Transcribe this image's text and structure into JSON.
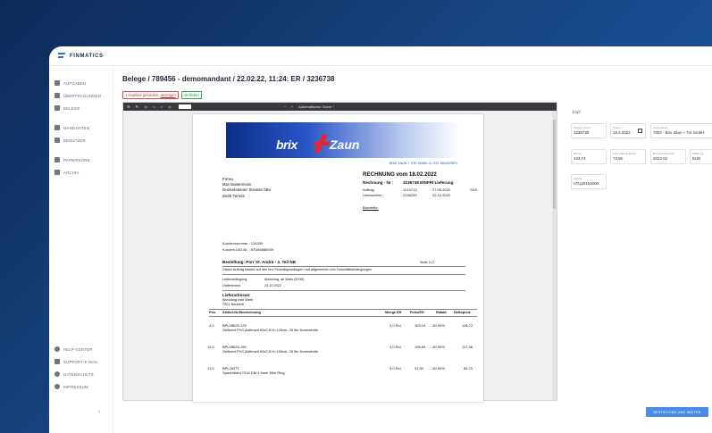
{
  "app": {
    "logo_text": "FINMATICS"
  },
  "sidebar": {
    "items": [
      {
        "label": "AUFGABEN"
      },
      {
        "label": "ÜBERTRAGUNGEN"
      },
      {
        "label": "BELEGE"
      },
      {
        "label": "MANDANTEN"
      },
      {
        "label": "BENUTZER"
      },
      {
        "label": "PAPIERKORB"
      },
      {
        "label": "ARCHIV"
      }
    ],
    "bottom_items": [
      {
        "label": "HELP-CENTER"
      },
      {
        "label": "SUPPORT-E-MAIL"
      },
      {
        "label": "DATENSCHUTZ"
      },
      {
        "label": "IMPRESSUM"
      }
    ],
    "collapse": "‹"
  },
  "header": {
    "title": "Belege / 789456 - demomandant / 22.02.22, 11:24: ER / 3236738",
    "duplicate_text": "1 Duplikat gefunden:",
    "duplicate_link": "anzeigen",
    "verified": "Verifiziert"
  },
  "viewer": {
    "zoom_label": "Automatischer Zoom ÷",
    "page_number": "",
    "toolbar_icons": [
      "☰",
      "🔍",
      "|<",
      "<",
      ">",
      ">|",
      "−",
      "+"
    ]
  },
  "invoice": {
    "brand_left": "brix",
    "brand_right": "Zaun",
    "address_line": "BRIX ZAUN + TOR GMBH, A-7221 NEUDÖRFL",
    "title": "RECHNUNG  vom  18.02.2022",
    "rechnung_nr_label": "Rechnung - Nr :",
    "rechnung_nr_value": "3236738 EINFRI Lieferung",
    "auftrag_label": "Auftrag",
    "auftrag_value": "1213713",
    "auftrag_date": "27.05.2022",
    "sas": "SAS",
    "lieferschein_label": "Lieferschein",
    "lieferschein_value": "2246293",
    "lieferschein_date": "22.10.2022",
    "baustelle": "Baustelle:",
    "firma": "Firma",
    "name": "Max Mustermann",
    "street": "Dunkelsteiner Strasse 09a",
    "city": "2630 Ternitz",
    "kundennummer": "Kundennummer : 126309",
    "uid": "Kunden-UID-Nr. : ATU66666939",
    "bestellung": "Bestellung:  Porr St. Andrä - 3. Teil  NB",
    "seite": "Seite      1/   2",
    "agb_note": "Dieser Auftrag basiert auf den brix Produktgrundlagen und allgemeinen brix-Geschäftsbedingungen",
    "lieferbedingung_label": "Lieferbedingung",
    "lieferbedingung_value": "Abholung,  ab Werk (EXW)",
    "liefertermin_label": "Liefertermin",
    "liefertermin_value": "23.10.2022",
    "lieferadresse": "Lieferadresse:",
    "lieferadresse_1": "Abholung vom Werk",
    "lieferadresse_2": "7201 Neudörfl",
    "table_headers": [
      "Pos.",
      "Artikel-Nr./Bezeichnung",
      "Menge EH",
      "Preis/EH",
      "Rabatt",
      "Nettopreis"
    ],
    "rows": [
      {
        "pos": "4,0",
        "art": "BPL08625-125",
        "desc": "Geflecht PVC Anthrazit 60x2,5 H=125cm, 25 lfm Normalrolle",
        "menge": "2,0 Rol",
        "preis": "163,10",
        "rabatt": "-40,00%",
        "netto": "195,72"
      },
      {
        "pos": "12,0",
        "art": "BPL08625-150",
        "desc": "Geflecht PVC Anthrazit 60x2,5 H=150cm, 25 lfm Normalrolle",
        "menge": "1,0 Rol",
        "preis": "195,60",
        "rabatt": "-40,00%",
        "netto": "117,36"
      },
      {
        "pos": "13,0",
        "art": "BPL28371",
        "desc": "Spanndraht 7016 DM 3,5mm 80m Ring",
        "menge": "3,0 Rol",
        "preis": "31,50",
        "rabatt": "-40,00%",
        "netto": "56,70"
      }
    ]
  },
  "form": {
    "section": "Kopf",
    "fields": [
      {
        "label": "Belegnummer *",
        "value": "3236738"
      },
      {
        "label": "Datum *",
        "value": "18.2.2022"
      },
      {
        "label": "Gegenkonto",
        "value": "7002 - Brix Zaun + Tor GmbH"
      },
      {
        "label": "Betrag",
        "value": "443,74"
      },
      {
        "label": "Steuerbetrag Brutto",
        "value": "73,96"
      },
      {
        "label": "Buchungsperiode *",
        "value": "2022-02"
      },
      {
        "label": "Währung",
        "value": "EUR"
      },
      {
        "label": "UID-Nr.",
        "value": "ATU20154000"
      }
    ],
    "submit": "BESTÄTIGEN UND WEITER"
  },
  "colors": {
    "accent": "#4a8be8",
    "brand_blue": "#0b2e8a",
    "brand_red": "#e8252c",
    "sidebar_text": "#5b6676"
  }
}
